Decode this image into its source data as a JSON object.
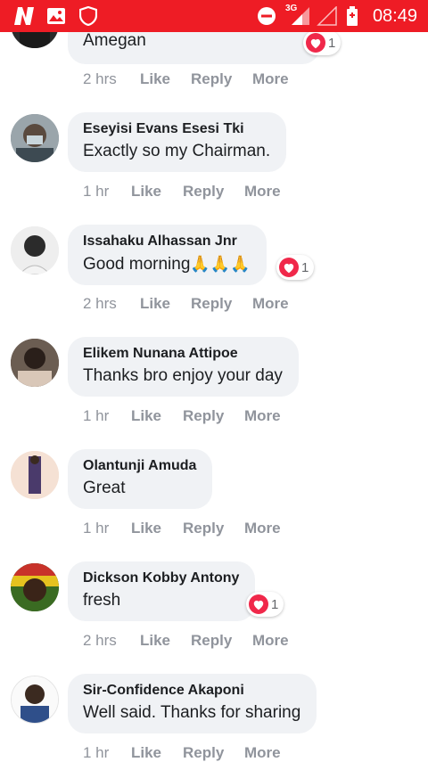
{
  "status_bar": {
    "time": "08:49",
    "network": "3G",
    "icons": [
      "news-app-icon",
      "gallery-icon",
      "shield-icon",
      "do-not-disturb-icon",
      "signal-icon",
      "battery-icon"
    ]
  },
  "actions": {
    "like": "Like",
    "reply": "Reply",
    "more": "More"
  },
  "comments": [
    {
      "author": "",
      "text": "Amegan",
      "time": "2 hrs",
      "reaction_count": "1"
    },
    {
      "author": "Eseyisi Evans Esesi Tki",
      "text": "Exactly so my Chairman.",
      "time": "1 hr"
    },
    {
      "author": "Issahaku Alhassan Jnr",
      "text": "Good morning",
      "emoji": "🙏🙏🙏",
      "time": "2 hrs",
      "reaction_count": "1"
    },
    {
      "author": "Elikem Nunana Attipoe",
      "text": "Thanks bro enjoy your day",
      "time": "1 hr"
    },
    {
      "author": "Olantunji Amuda",
      "text": "Great",
      "time": "1 hr"
    },
    {
      "author": "Dickson Kobby Antony",
      "text": "fresh",
      "time": "2 hrs",
      "reaction_count": "1"
    },
    {
      "author": "Sir-Confidence Akaponi",
      "text": "Well said. Thanks for sharing",
      "time": "1 hr"
    }
  ],
  "colors": {
    "status_bar": "#ee1c25",
    "bubble": "#f0f2f5",
    "reaction_heart": "#f0284a",
    "action_text": "#90949c"
  }
}
